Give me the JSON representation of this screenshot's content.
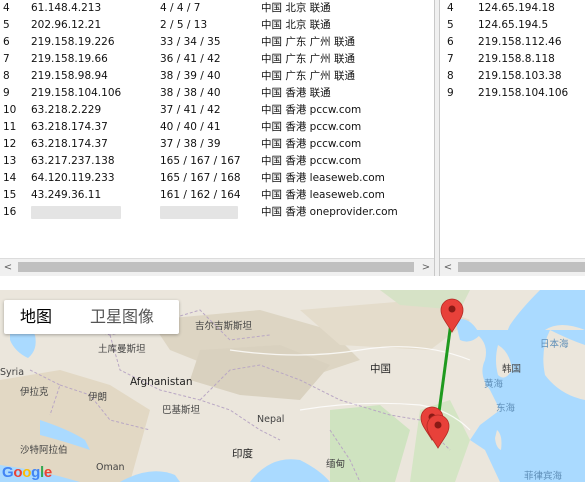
{
  "left_table": {
    "rows": [
      {
        "hop": "4",
        "ip": "61.148.4.213",
        "latency": "4 / 4 / 7",
        "location": "中国 北京 联通"
      },
      {
        "hop": "5",
        "ip": "202.96.12.21",
        "latency": "2 / 5 / 13",
        "location": "中国 北京 联通"
      },
      {
        "hop": "6",
        "ip": "219.158.19.226",
        "latency": "33 / 34 / 35",
        "location": "中国 广东 广州 联通"
      },
      {
        "hop": "7",
        "ip": "219.158.19.66",
        "latency": "36 / 41 / 42",
        "location": "中国 广东 广州 联通"
      },
      {
        "hop": "8",
        "ip": "219.158.98.94",
        "latency": "38 / 39 / 40",
        "location": "中国 广东 广州 联通"
      },
      {
        "hop": "9",
        "ip": "219.158.104.106",
        "latency": "38 / 38 / 40",
        "location": "中国 香港 联通"
      },
      {
        "hop": "10",
        "ip": "63.218.2.229",
        "latency": "37 / 41 / 42",
        "location": "中国 香港 pccw.com"
      },
      {
        "hop": "11",
        "ip": "63.218.174.37",
        "latency": "40 / 40 / 41",
        "location": "中国 香港 pccw.com"
      },
      {
        "hop": "12",
        "ip": "63.218.174.37",
        "latency": "37 / 38 / 39",
        "location": "中国 香港 pccw.com"
      },
      {
        "hop": "13",
        "ip": "63.217.237.138",
        "latency": "165 / 167 / 167",
        "location": "中国 香港 pccw.com"
      },
      {
        "hop": "14",
        "ip": "64.120.119.233",
        "latency": "165 / 167 / 168",
        "location": "中国 香港 leaseweb.com"
      },
      {
        "hop": "15",
        "ip": "43.249.36.11",
        "latency": "161 / 162 / 164",
        "location": "中国 香港 leaseweb.com"
      },
      {
        "hop": "16",
        "ip": "",
        "latency": "",
        "location": "中国 香港 oneprovider.com"
      }
    ]
  },
  "right_table": {
    "rows": [
      {
        "hop": "4",
        "ip": "124.65.194.18"
      },
      {
        "hop": "5",
        "ip": "124.65.194.5"
      },
      {
        "hop": "6",
        "ip": "219.158.112.46"
      },
      {
        "hop": "7",
        "ip": "219.158.8.118"
      },
      {
        "hop": "8",
        "ip": "219.158.103.38"
      },
      {
        "hop": "9",
        "ip": "219.158.104.106"
      }
    ]
  },
  "scrollbars": {
    "left_arrow": "<",
    "right_arrow": ">"
  },
  "map": {
    "type_buttons": {
      "map": "地图",
      "satellite": "卫星图像"
    },
    "labels": {
      "turkmenistan": "土库曼斯坦",
      "kyrgyzstan": "吉尔吉斯斯坦",
      "syria": "Syria",
      "iraq": "伊拉克",
      "afghanistan": "Afghanistan",
      "iran": "伊朗",
      "pakistan": "巴基斯坦",
      "china": "中国",
      "nepal": "Nepal",
      "saudi": "沙特阿拉伯",
      "oman": "Oman",
      "india": "印度",
      "myanmar": "缅甸",
      "japan_sea": "日本海",
      "korea": "韩国",
      "yellow_sea": "黄海",
      "east_sea": "东海",
      "philippine_sea": "菲律宾海"
    },
    "attribution": "Google",
    "route_color": "#1f9a1f",
    "marker_color": "#e8413a"
  }
}
